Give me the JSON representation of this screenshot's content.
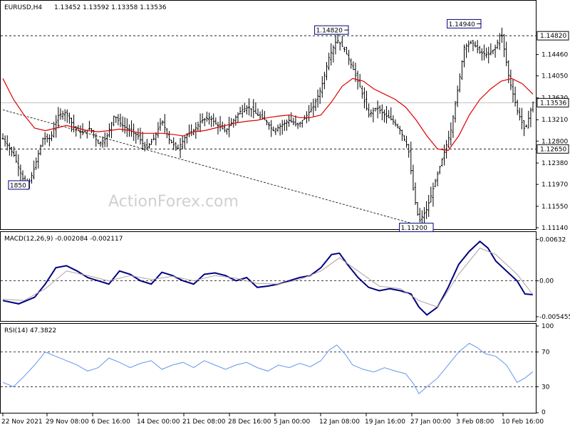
{
  "header": {
    "symbol": "EURUSD,H4",
    "ohlc": "1.13452 1.13592 1.13358 1.13536"
  },
  "watermark": "ActionForex.com",
  "colors": {
    "candles": "#000000",
    "ma": "#e00000",
    "macd": "#000080",
    "signal": "#b0a0a0",
    "rsi": "#6495ed",
    "dashed": "#000000"
  },
  "chart_data": [
    {
      "type": "candlestick",
      "name": "price",
      "ylim": [
        1.1114,
        1.1545
      ],
      "yticks": [
        "1.14820",
        "1.14460",
        "1.14050",
        "1.13630",
        "1.13210",
        "1.12800",
        "1.12380",
        "1.11970",
        "1.11550",
        "1.11140"
      ],
      "ytick_values": [
        1.1482,
        1.1446,
        1.1405,
        1.1363,
        1.1321,
        1.128,
        1.1238,
        1.1197,
        1.1155,
        1.1114
      ],
      "current_price_label": "1.13536",
      "current_price": 1.13536,
      "hlines": [
        {
          "label": "1.14820",
          "value": 1.1482,
          "style": "dashed"
        },
        {
          "label": "1.12650",
          "value": 1.1265,
          "style": "dashed"
        }
      ],
      "annotations": [
        {
          "text": "1.14820",
          "x_index": 0.62,
          "value": 1.1482
        },
        {
          "text": "1.14940",
          "x_index": 0.87,
          "value": 1.1494
        },
        {
          "text": "1.11200",
          "x_index": 0.78,
          "value": 1.112
        },
        {
          "text": "1850",
          "x_index": 0.03,
          "value": 1.1185
        }
      ],
      "trendline": {
        "from": [
          0.0,
          1.134
        ],
        "to": [
          0.78,
          1.112
        ]
      },
      "close_path": [
        [
          0.0,
          1.1285
        ],
        [
          0.02,
          1.1255
        ],
        [
          0.035,
          1.1215
        ],
        [
          0.045,
          1.1188
        ],
        [
          0.06,
          1.123
        ],
        [
          0.075,
          1.1285
        ],
        [
          0.09,
          1.1285
        ],
        [
          0.105,
          1.133
        ],
        [
          0.12,
          1.1335
        ],
        [
          0.135,
          1.1305
        ],
        [
          0.15,
          1.1295
        ],
        [
          0.165,
          1.1305
        ],
        [
          0.18,
          1.1275
        ],
        [
          0.195,
          1.1285
        ],
        [
          0.21,
          1.133
        ],
        [
          0.225,
          1.131
        ],
        [
          0.24,
          1.13
        ],
        [
          0.255,
          1.129
        ],
        [
          0.27,
          1.1265
        ],
        [
          0.285,
          1.1285
        ],
        [
          0.3,
          1.132
        ],
        [
          0.315,
          1.128
        ],
        [
          0.33,
          1.1265
        ],
        [
          0.345,
          1.129
        ],
        [
          0.36,
          1.13
        ],
        [
          0.375,
          1.132
        ],
        [
          0.39,
          1.1325
        ],
        [
          0.405,
          1.131
        ],
        [
          0.42,
          1.13
        ],
        [
          0.435,
          1.132
        ],
        [
          0.45,
          1.134
        ],
        [
          0.465,
          1.1345
        ],
        [
          0.48,
          1.133
        ],
        [
          0.495,
          1.132
        ],
        [
          0.51,
          1.13
        ],
        [
          0.525,
          1.131
        ],
        [
          0.54,
          1.132
        ],
        [
          0.555,
          1.131
        ],
        [
          0.57,
          1.1325
        ],
        [
          0.585,
          1.1345
        ],
        [
          0.6,
          1.138
        ],
        [
          0.615,
          1.144
        ],
        [
          0.63,
          1.1475
        ],
        [
          0.645,
          1.1455
        ],
        [
          0.66,
          1.142
        ],
        [
          0.675,
          1.138
        ],
        [
          0.69,
          1.133
        ],
        [
          0.705,
          1.1345
        ],
        [
          0.72,
          1.133
        ],
        [
          0.735,
          1.132
        ],
        [
          0.75,
          1.13
        ],
        [
          0.765,
          1.1265
        ],
        [
          0.775,
          1.118
        ],
        [
          0.785,
          1.1125
        ],
        [
          0.8,
          1.115
        ],
        [
          0.815,
          1.12
        ],
        [
          0.83,
          1.125
        ],
        [
          0.845,
          1.13
        ],
        [
          0.86,
          1.139
        ],
        [
          0.87,
          1.146
        ],
        [
          0.885,
          1.147
        ],
        [
          0.9,
          1.145
        ],
        [
          0.915,
          1.1445
        ],
        [
          0.93,
          1.146
        ],
        [
          0.94,
          1.149
        ],
        [
          0.955,
          1.14
        ],
        [
          0.97,
          1.134
        ],
        [
          0.985,
          1.13
        ],
        [
          1.0,
          1.1354
        ]
      ],
      "ma_path": [
        [
          0.0,
          1.14
        ],
        [
          0.02,
          1.136
        ],
        [
          0.04,
          1.133
        ],
        [
          0.06,
          1.1305
        ],
        [
          0.08,
          1.13
        ],
        [
          0.1,
          1.1305
        ],
        [
          0.12,
          1.131
        ],
        [
          0.14,
          1.1305
        ],
        [
          0.16,
          1.13
        ],
        [
          0.18,
          1.1298
        ],
        [
          0.2,
          1.13
        ],
        [
          0.22,
          1.1303
        ],
        [
          0.24,
          1.13
        ],
        [
          0.26,
          1.1295
        ],
        [
          0.28,
          1.1295
        ],
        [
          0.3,
          1.1295
        ],
        [
          0.32,
          1.1293
        ],
        [
          0.34,
          1.129
        ],
        [
          0.36,
          1.1298
        ],
        [
          0.38,
          1.13
        ],
        [
          0.4,
          1.1305
        ],
        [
          0.42,
          1.131
        ],
        [
          0.44,
          1.1315
        ],
        [
          0.46,
          1.1318
        ],
        [
          0.48,
          1.132
        ],
        [
          0.5,
          1.1325
        ],
        [
          0.52,
          1.1328
        ],
        [
          0.54,
          1.133
        ],
        [
          0.56,
          1.1325
        ],
        [
          0.58,
          1.1325
        ],
        [
          0.6,
          1.133
        ],
        [
          0.62,
          1.1355
        ],
        [
          0.64,
          1.1385
        ],
        [
          0.66,
          1.14
        ],
        [
          0.68,
          1.1395
        ],
        [
          0.7,
          1.138
        ],
        [
          0.72,
          1.137
        ],
        [
          0.74,
          1.136
        ],
        [
          0.76,
          1.1345
        ],
        [
          0.78,
          1.132
        ],
        [
          0.8,
          1.129
        ],
        [
          0.82,
          1.1265
        ],
        [
          0.84,
          1.1262
        ],
        [
          0.86,
          1.129
        ],
        [
          0.88,
          1.133
        ],
        [
          0.9,
          1.136
        ],
        [
          0.92,
          1.138
        ],
        [
          0.94,
          1.1395
        ],
        [
          0.96,
          1.14
        ],
        [
          0.98,
          1.139
        ],
        [
          1.0,
          1.137
        ]
      ]
    },
    {
      "type": "line",
      "name": "MACD(12,26,9) -0.002084 -0.002117",
      "ylim": [
        -0.006,
        0.007
      ],
      "yticks": [
        "0.00632",
        "0.00",
        "-0.005455"
      ],
      "ytick_values": [
        0.00632,
        0.0,
        -0.005455
      ],
      "series": [
        {
          "name": "macd",
          "points": [
            [
              0.0,
              -0.003
            ],
            [
              0.03,
              -0.0035
            ],
            [
              0.06,
              -0.0025
            ],
            [
              0.08,
              -0.0005
            ],
            [
              0.1,
              0.002
            ],
            [
              0.12,
              0.0023
            ],
            [
              0.14,
              0.0015
            ],
            [
              0.16,
              0.0005
            ],
            [
              0.18,
              0.0
            ],
            [
              0.2,
              -0.0005
            ],
            [
              0.22,
              0.0015
            ],
            [
              0.24,
              0.001
            ],
            [
              0.26,
              0.0
            ],
            [
              0.28,
              -0.0005
            ],
            [
              0.3,
              0.0013
            ],
            [
              0.32,
              0.0008
            ],
            [
              0.34,
              0.0
            ],
            [
              0.36,
              -0.0005
            ],
            [
              0.38,
              0.001
            ],
            [
              0.4,
              0.0012
            ],
            [
              0.42,
              0.0008
            ],
            [
              0.44,
              0.0
            ],
            [
              0.46,
              0.0005
            ],
            [
              0.48,
              -0.001
            ],
            [
              0.5,
              -0.0008
            ],
            [
              0.52,
              -0.0005
            ],
            [
              0.54,
              0.0
            ],
            [
              0.56,
              0.0005
            ],
            [
              0.58,
              0.0008
            ],
            [
              0.6,
              0.002
            ],
            [
              0.62,
              0.004
            ],
            [
              0.635,
              0.0042
            ],
            [
              0.65,
              0.0025
            ],
            [
              0.67,
              0.0005
            ],
            [
              0.69,
              -0.001
            ],
            [
              0.71,
              -0.0015
            ],
            [
              0.73,
              -0.0012
            ],
            [
              0.75,
              -0.0015
            ],
            [
              0.77,
              -0.002
            ],
            [
              0.785,
              -0.004
            ],
            [
              0.8,
              -0.0052
            ],
            [
              0.82,
              -0.004
            ],
            [
              0.84,
              -0.001
            ],
            [
              0.86,
              0.0025
            ],
            [
              0.88,
              0.0045
            ],
            [
              0.9,
              0.006
            ],
            [
              0.915,
              0.005
            ],
            [
              0.93,
              0.003
            ],
            [
              0.95,
              0.0015
            ],
            [
              0.97,
              0.0
            ],
            [
              0.985,
              -0.002
            ],
            [
              1.0,
              -0.0021
            ]
          ]
        },
        {
          "name": "signal",
          "points": [
            [
              0.0,
              -0.0028
            ],
            [
              0.04,
              -0.003
            ],
            [
              0.08,
              -0.0012
            ],
            [
              0.12,
              0.0015
            ],
            [
              0.16,
              0.0008
            ],
            [
              0.2,
              0.0
            ],
            [
              0.24,
              0.0008
            ],
            [
              0.28,
              0.0002
            ],
            [
              0.32,
              0.0007
            ],
            [
              0.36,
              0.0
            ],
            [
              0.4,
              0.0008
            ],
            [
              0.44,
              0.0004
            ],
            [
              0.48,
              -0.0004
            ],
            [
              0.52,
              -0.0005
            ],
            [
              0.56,
              0.0002
            ],
            [
              0.6,
              0.0015
            ],
            [
              0.635,
              0.0035
            ],
            [
              0.67,
              0.0015
            ],
            [
              0.71,
              -0.0008
            ],
            [
              0.75,
              -0.0012
            ],
            [
              0.785,
              -0.003
            ],
            [
              0.82,
              -0.004
            ],
            [
              0.86,
              0.001
            ],
            [
              0.9,
              0.005
            ],
            [
              0.93,
              0.004
            ],
            [
              0.97,
              0.001
            ],
            [
              1.0,
              -0.0021
            ]
          ]
        }
      ]
    },
    {
      "type": "line",
      "name": "RSI(14) 47.3822",
      "ylim": [
        0,
        100
      ],
      "yticks": [
        "100",
        "70",
        "30",
        "0"
      ],
      "ytick_values": [
        100,
        70,
        30,
        0
      ],
      "levels": [
        70,
        30
      ],
      "series": [
        {
          "name": "rsi",
          "points": [
            [
              0.0,
              35
            ],
            [
              0.02,
              30
            ],
            [
              0.04,
              42
            ],
            [
              0.06,
              55
            ],
            [
              0.08,
              70
            ],
            [
              0.1,
              65
            ],
            [
              0.12,
              60
            ],
            [
              0.14,
              55
            ],
            [
              0.16,
              48
            ],
            [
              0.18,
              52
            ],
            [
              0.2,
              63
            ],
            [
              0.22,
              58
            ],
            [
              0.24,
              52
            ],
            [
              0.26,
              57
            ],
            [
              0.28,
              60
            ],
            [
              0.3,
              50
            ],
            [
              0.32,
              55
            ],
            [
              0.34,
              58
            ],
            [
              0.36,
              52
            ],
            [
              0.38,
              60
            ],
            [
              0.4,
              55
            ],
            [
              0.42,
              50
            ],
            [
              0.44,
              55
            ],
            [
              0.46,
              58
            ],
            [
              0.48,
              52
            ],
            [
              0.5,
              48
            ],
            [
              0.52,
              55
            ],
            [
              0.54,
              52
            ],
            [
              0.56,
              57
            ],
            [
              0.58,
              53
            ],
            [
              0.6,
              60
            ],
            [
              0.615,
              72
            ],
            [
              0.63,
              78
            ],
            [
              0.645,
              68
            ],
            [
              0.66,
              55
            ],
            [
              0.68,
              50
            ],
            [
              0.7,
              47
            ],
            [
              0.72,
              52
            ],
            [
              0.74,
              48
            ],
            [
              0.76,
              45
            ],
            [
              0.775,
              33
            ],
            [
              0.785,
              22
            ],
            [
              0.8,
              30
            ],
            [
              0.82,
              40
            ],
            [
              0.84,
              55
            ],
            [
              0.86,
              70
            ],
            [
              0.88,
              80
            ],
            [
              0.895,
              75
            ],
            [
              0.91,
              68
            ],
            [
              0.93,
              65
            ],
            [
              0.95,
              55
            ],
            [
              0.97,
              35
            ],
            [
              0.985,
              40
            ],
            [
              1.0,
              47.38
            ]
          ]
        }
      ]
    }
  ],
  "xaxis": {
    "labels": [
      "22 Nov 2021",
      "29 Nov 08:00",
      "6 Dec 16:00",
      "14 Dec 00:00",
      "21 Dec 08:00",
      "28 Dec 16:00",
      "5 Jan 00:00",
      "12 Jan 08:00",
      "19 Jan 16:00",
      "27 Jan 00:00",
      "3 Feb 08:00",
      "10 Feb 16:00"
    ]
  }
}
